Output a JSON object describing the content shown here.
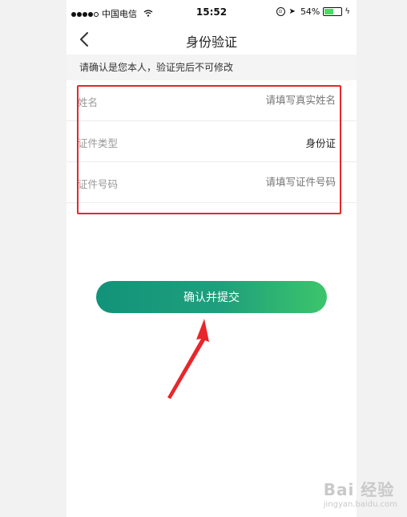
{
  "status_bar": {
    "carrier": "中国电信",
    "time": "15:52",
    "battery": "54%",
    "battery_level": 0.54
  },
  "nav": {
    "title": "身份验证",
    "back_icon": "chevron-left-icon"
  },
  "notice": "请确认是您本人，验证完后不可修改",
  "form": {
    "rows": [
      {
        "label": "姓名",
        "placeholder": "请填写真实姓名"
      },
      {
        "label": "证件类型",
        "value": "身份证"
      },
      {
        "label": "证件号码",
        "placeholder": "请填写证件号码"
      }
    ]
  },
  "submit_label": "确认并提交",
  "colors": {
    "accent_start": "#12937a",
    "accent_end": "#3cc56b",
    "annotation_red": "#e8262b"
  },
  "watermark": {
    "logo": "Bai 经验",
    "url": "jingyan.baidu.com"
  }
}
